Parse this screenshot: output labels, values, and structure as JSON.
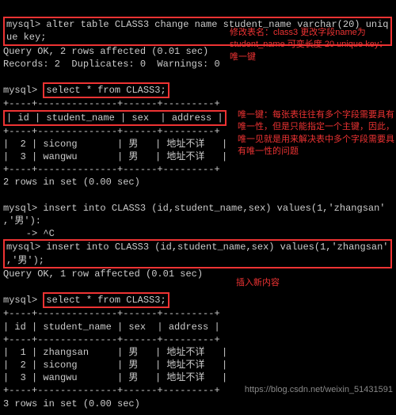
{
  "prompt": "mysql>",
  "cmd1_a": "alter table CLASS3 change name student_name varchar(20) uniq",
  "cmd1_b": "ue key;",
  "res1_a": "Query OK, 2 rows affected (0.01 sec)",
  "res1_b": "Records: 2  Duplicates: 0  Warnings: 0",
  "cmd2": "select * from CLASS3;",
  "tbl_sep": "+----+--------------+------+---------+",
  "tbl_hdr": "| id | student_name | sex  | address |",
  "tbl1_r1": "|  2 | sicong       | 男   | 地址不详   |",
  "tbl1_r2": "|  3 | wangwu       | 男   | 地址不详   |",
  "res2": "2 rows in set (0.00 sec)",
  "cmd3_a": "insert into CLASS3 (id,student_name,sex) values(1,'zhangsan'",
  "cmd3_b": ",'男'):",
  "cmd3_c": "    -> ^C",
  "cmd4_a": "insert into CLASS3 (id,student_name,sex) values(1,'zhangsan'",
  "cmd4_b": ",'男');",
  "res4": "Query OK, 1 row affected (0.01 sec)",
  "cmd5": "select * from CLASS3;",
  "tbl2_r1": "|  1 | zhangsan     | 男   | 地址不详   |",
  "tbl2_r2": "|  2 | sicong       | 男   | 地址不详   |",
  "tbl2_r3": "|  3 | wangwu       | 男   | 地址不详   |",
  "res5": "3 rows in set (0.00 sec)",
  "anno1": "修改表名：class3 更改字段name为 student_name 可变长度 20 unique key：唯一键",
  "anno2": "唯一键：每张表往往有多个字段需要具有唯一性，但是只能指定一个主键，因此，唯一见就是用来解决表中多个字段需要具有唯一性的问题",
  "anno3": "插入新内容",
  "watermark": "https://blog.csdn.net/weixin_51431591"
}
